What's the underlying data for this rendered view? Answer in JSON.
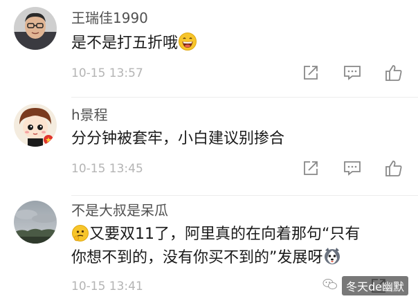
{
  "comments": [
    {
      "username": "王瑞佳1990",
      "text": "是不是打五折哦",
      "time": "10-15 13:57",
      "emoji": "grin-face"
    },
    {
      "username": "h景程",
      "text": "分分钟被套牢，小白建议别掺合",
      "time": "10-15 13:45"
    },
    {
      "username": "不是大叔是呆瓜",
      "text_line1_prefix": "又要双11了，阿里真的在向着那句“只有",
      "text_line2": "你想不到的，没有你买不到的”发展呀",
      "time": "10-15 13:41",
      "emoji_start": "thinking-face",
      "emoji_end": "husky-face"
    }
  ],
  "actions": [
    "share-icon",
    "comment-icon",
    "like-icon"
  ],
  "watermark": "冬天de幽默"
}
